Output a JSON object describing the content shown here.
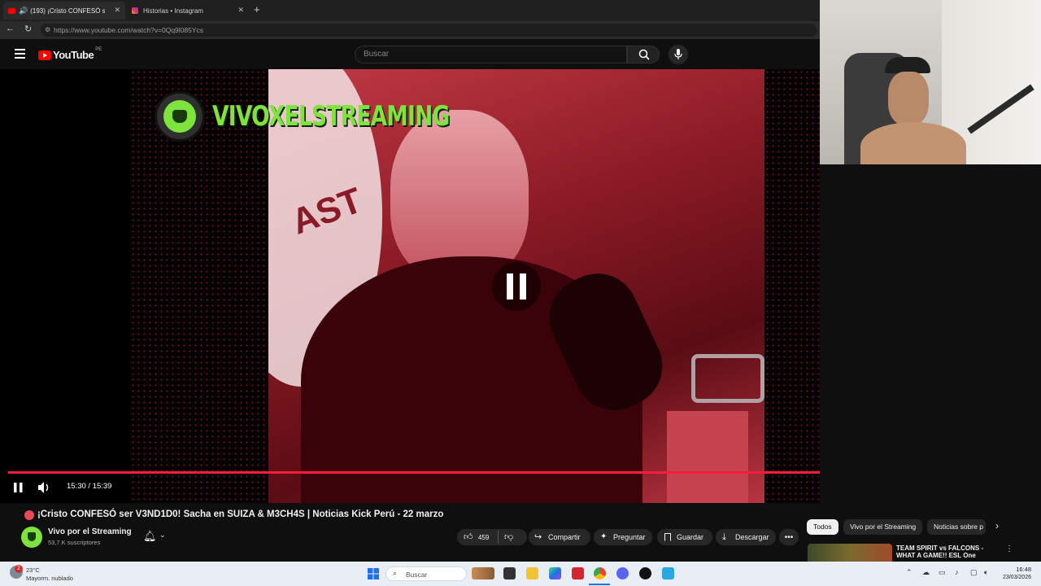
{
  "browser": {
    "tabs": [
      {
        "label": "(193) ¡Cristo CONFESÓ se",
        "active": true
      },
      {
        "label": "Historias • Instagram",
        "active": false
      }
    ],
    "url": "https://www.youtube.com/watch?v=0Qq9l085Ycs"
  },
  "youtube": {
    "logo_text": "YouTube",
    "region_badge": "PE",
    "search_placeholder": "Buscar"
  },
  "player": {
    "overlay_channel": "VIVOXELSTREAMING",
    "current_time": "15:30",
    "duration": "15:39",
    "time_display": "15:30 / 15:39",
    "progress_fraction": 0.99,
    "state": "paused-icon-shown"
  },
  "video": {
    "title": "¡Cristo CONFESÓ ser V3ND1D0! Sacha en SUIZA & M3CH4S | Noticias Kick Perú - 22 marzo",
    "channel_name": "Vivo por el Streaming",
    "subscribers": "53,7 K suscriptores",
    "likes": "459",
    "share_label": "Compartir",
    "ask_label": "Preguntar",
    "save_label": "Guardar",
    "download_label": "Descargar"
  },
  "sidebar": {
    "chips": [
      "Todos",
      "Vivo por el Streaming",
      "Noticias sobre p"
    ],
    "next_video_title": "TEAM SPIRIT vs FALCONS - WHAT A GAME!! ESL One"
  },
  "taskbar": {
    "temperature": "23°C",
    "weather": "Mayorm. nublado",
    "notification_count": "2",
    "search_label": "Buscar",
    "time": "16:48",
    "date": "23/03/2026"
  },
  "colors": {
    "accent": "#ff1b3a",
    "yt_red": "#ff0000",
    "overlay_green": "#7ee33b",
    "background": "#0f0f0f"
  }
}
